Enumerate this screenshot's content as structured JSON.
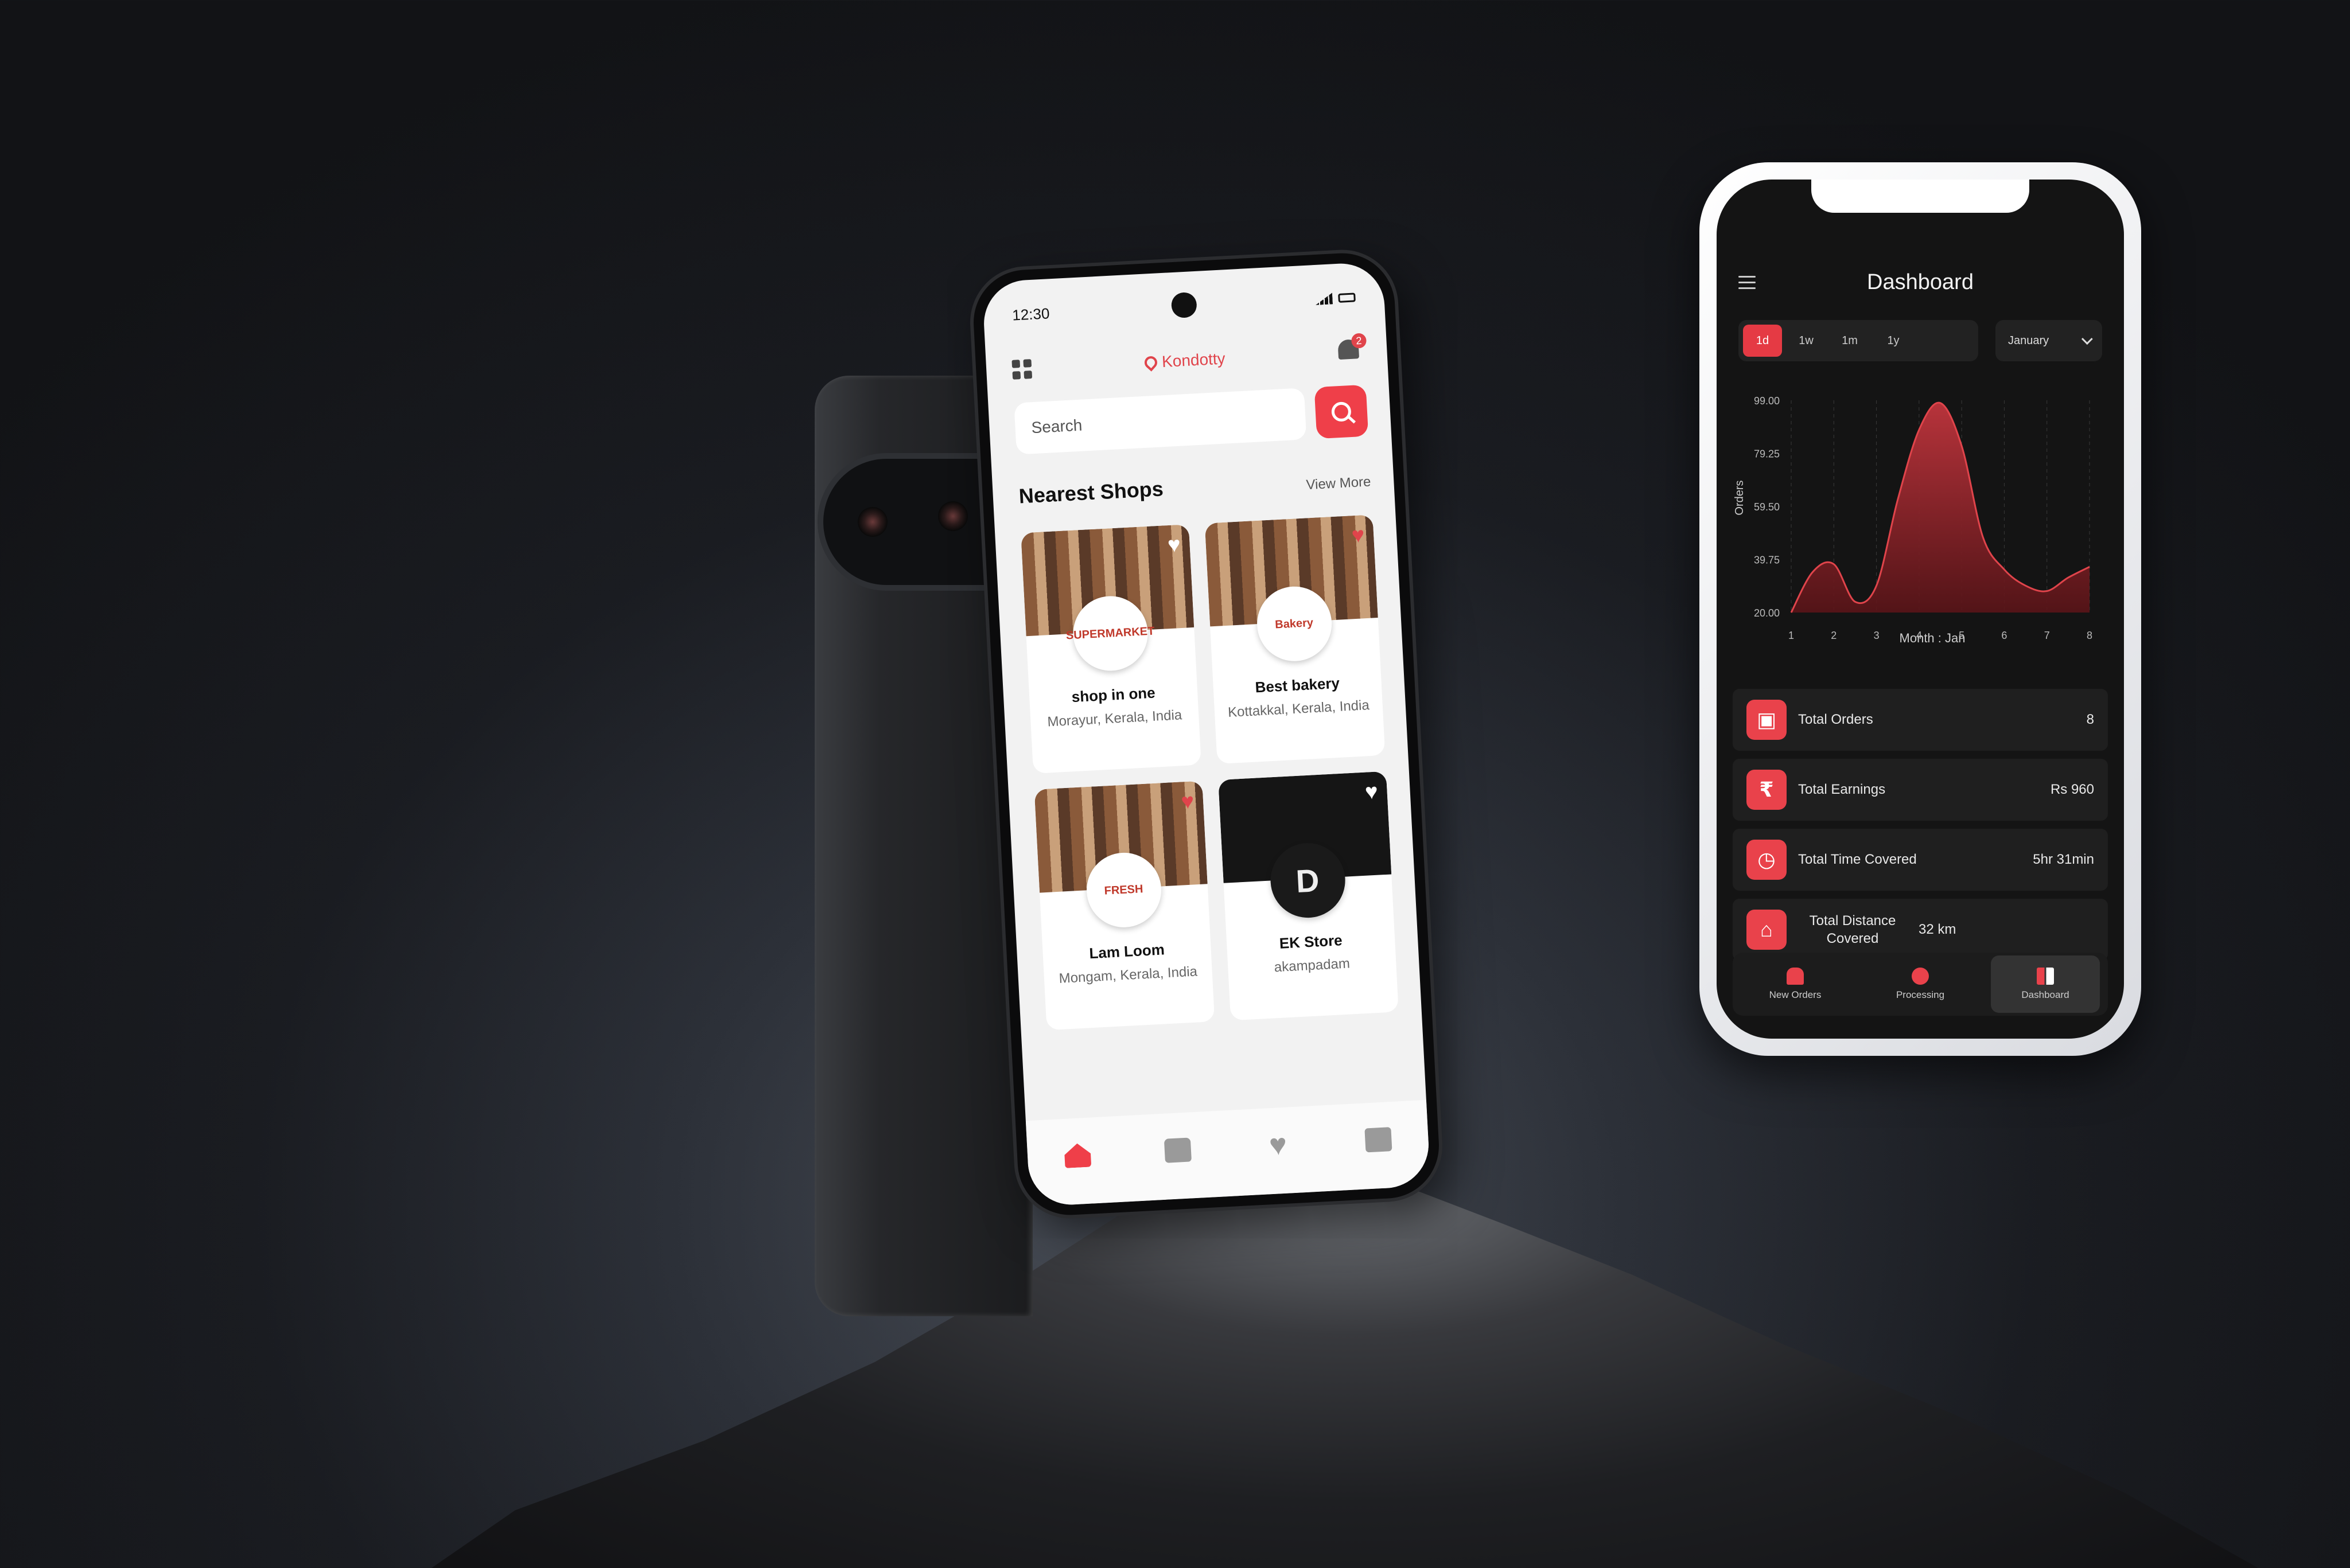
{
  "shop_app": {
    "status_time": "12:30",
    "location": "Kondotty",
    "notification_count": "2",
    "search_placeholder": "Search",
    "section_title": "Nearest Shops",
    "view_more": "View More",
    "shops": [
      {
        "name": "shop in one",
        "location": "Morayur, Kerala, India",
        "logo_text": "SUPERMARKET",
        "favorited": false
      },
      {
        "name": "Best bakery",
        "location": "Kottakkal, Kerala, India",
        "logo_text": "Bakery",
        "favorited": true
      },
      {
        "name": "Lam Loom",
        "location": "Mongam, Kerala, India",
        "logo_text": "FRESH",
        "favorited": true
      },
      {
        "name": "EK Store",
        "location": "akampadam",
        "logo_text": "D",
        "favorited": false
      }
    ],
    "bottom_nav": [
      "home-icon",
      "bag-icon",
      "heart-icon",
      "box-icon"
    ]
  },
  "dashboard": {
    "title": "Dashboard",
    "ranges": [
      "1d",
      "1w",
      "1m",
      "1y"
    ],
    "active_range": "1d",
    "month": "January",
    "stats": [
      {
        "label": "Total Orders",
        "value": "8",
        "icon": "box-icon"
      },
      {
        "label": "Total Earnings",
        "value": "Rs 960",
        "icon": "rupee-icon"
      },
      {
        "label": "Total Time Covered",
        "value": "5hr 31min",
        "icon": "clock-icon"
      },
      {
        "label": "Total Distance Covered",
        "value": "32 km",
        "icon": "map-icon"
      }
    ],
    "nav": [
      {
        "label": "New Orders",
        "icon": "bell-icon",
        "active": false
      },
      {
        "label": "Processing",
        "icon": "compass-icon",
        "active": false
      },
      {
        "label": "Dashboard",
        "icon": "dashboard-icon",
        "active": true
      }
    ]
  },
  "chart_data": {
    "type": "area",
    "x": [
      1,
      1.5,
      2,
      2.5,
      3,
      3.5,
      4,
      4.5,
      5,
      5.5,
      6,
      6.5,
      7,
      7.5,
      8
    ],
    "values": [
      20,
      35,
      38,
      24,
      30,
      62,
      88,
      98,
      82,
      48,
      36,
      30,
      28,
      33,
      37
    ],
    "xlabel": "Month : Jan",
    "ylabel": "Orders",
    "ylim": [
      20,
      99
    ],
    "y_ticks": [
      "99.00",
      "79.25",
      "59.50",
      "39.75",
      "20.00"
    ],
    "x_ticks": [
      "1",
      "2",
      "3",
      "4",
      "5",
      "6",
      "7",
      "8"
    ],
    "color": "#e0444b",
    "grid": "vertical dashed"
  }
}
